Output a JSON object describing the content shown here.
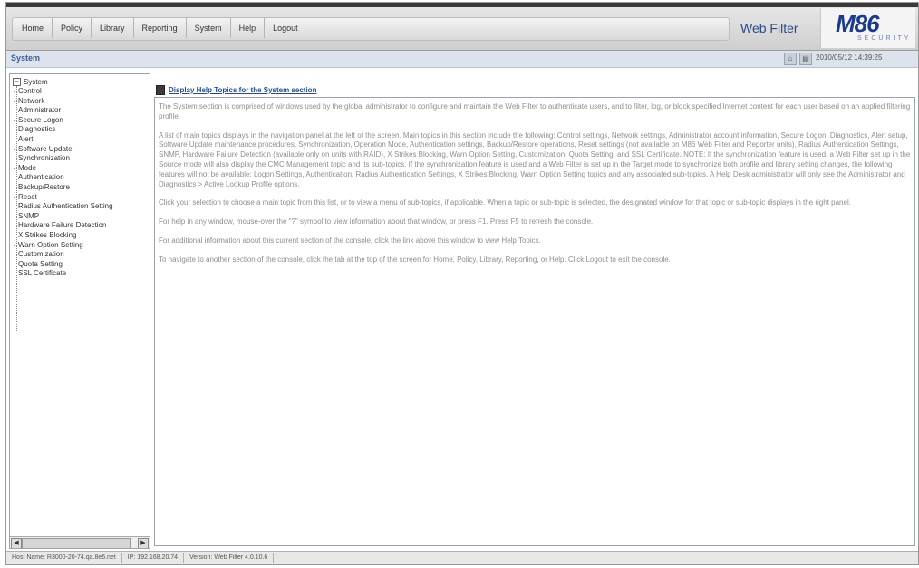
{
  "nav": {
    "tabs": [
      "Home",
      "Policy",
      "Library",
      "Reporting",
      "System",
      "Help",
      "Logout"
    ]
  },
  "branding": {
    "product": "Web Filter",
    "logo_text": "M86",
    "logo_sub": "SECURITY"
  },
  "section": {
    "title": "System",
    "timestamp": "2010/05/12 14:39:25"
  },
  "sidebar": {
    "root": "System",
    "items": [
      "Control",
      "Network",
      "Administrator",
      "Secure Logon",
      "Diagnostics",
      "Alert",
      "Software Update",
      "Synchronization",
      "Mode",
      "Authentication",
      "Backup/Restore",
      "Reset",
      "Radius Authentication Setting",
      "SNMP",
      "Hardware Failure Detection",
      "X Strikes Blocking",
      "Warn Option Setting",
      "Customization",
      "Quota Setting",
      "SSL Certificate"
    ]
  },
  "main": {
    "help_link": "Display Help Topics for the System section",
    "paragraphs": [
      "The System section is comprised of windows used by the global administrator to configure and maintain the Web Filter to authenticate users, and to filter, log, or block specified Internet content for each user based on an applied filtering profile.",
      "A list of main topics displays in the navigation panel at the left of the screen. Main topics in this section include the following: Control settings, Network settings, Administrator account information, Secure Logon, Diagnostics, Alert setup, Software Update maintenance procedures, Synchronization, Operation Mode, Authentication settings, Backup/Restore operations, Reset settings (not available on M86 Web Filter and Reporter units), Radius Authentication Settings, SNMP, Hardware Failure Detection (available only on units with RAID), X Strikes Blocking, Warn Option Setting, Customization, Quota Setting, and SSL Certificate. NOTE: If the synchronization feature is used, a Web Filter set up in the Source mode will also display the CMC Management topic and its sub-topics. If the synchronization feature is used and a Web Filter is set up in the Target mode to synchronize both profile and library setting changes, the following features will not be available: Logon Settings, Authentication, Radius Authentication Settings, X Strikes Blocking, Warn Option Setting topics and any associated sub-topics. A Help Desk administrator will only see the Administrator and Diagnostics > Active Lookup Profile options.",
      "Click your selection to choose a main topic from this list, or to view a menu of sub-topics, if applicable. When a topic or sub-topic is selected, the designated window for that topic or sub-topic displays in the right panel.",
      "For help in any window, mouse-over the \"?\" symbol to view information about that window, or press F1. Press F5 to refresh the console.",
      "For additional information about this current section of the console, click the link above this window to view Help Topics.",
      "To navigate to another section of the console, click the tab at the top of the screen for Home, Policy, Library, Reporting, or Help. Click Logout to exit the console."
    ]
  },
  "status": {
    "host": "Host Name: R3000-20-74.qa.8e6.net",
    "ip": "IP: 192.168.20.74",
    "version": "Version: Web Filter 4.0.10.6"
  }
}
